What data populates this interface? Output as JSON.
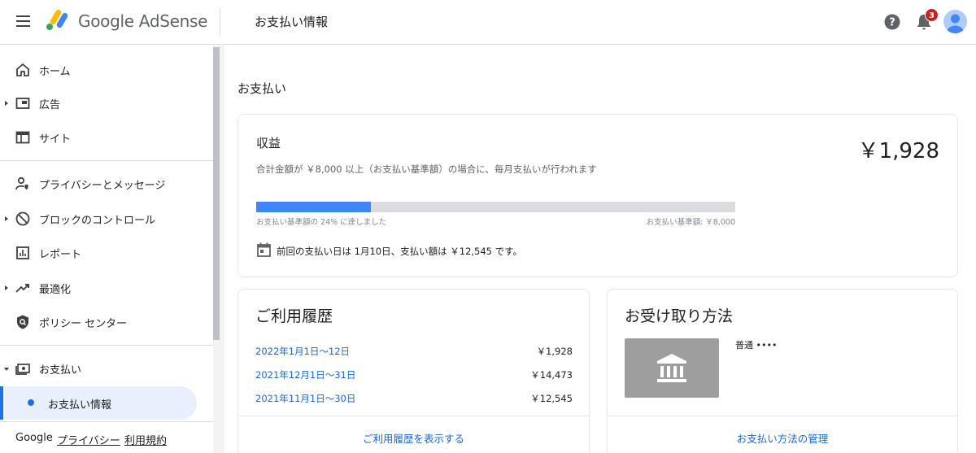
{
  "header": {
    "brand": "Google AdSense",
    "page_title": "お支払い情報",
    "notification_count": "3"
  },
  "sidebar": {
    "items": [
      {
        "label": "ホーム",
        "icon": "home-icon"
      },
      {
        "label": "広告",
        "icon": "ads-icon"
      },
      {
        "label": "サイト",
        "icon": "sites-icon"
      },
      {
        "label": "プライバシーとメッセージ",
        "icon": "privacy-messaging-icon"
      },
      {
        "label": "ブロックのコントロール",
        "icon": "block-icon"
      },
      {
        "label": "レポート",
        "icon": "reports-icon"
      },
      {
        "label": "最適化",
        "icon": "optimization-icon"
      },
      {
        "label": "ポリシー センター",
        "icon": "policy-center-icon"
      },
      {
        "label": "お支払い",
        "icon": "payments-icon"
      }
    ],
    "sub_item": "お支払い情報",
    "footer": {
      "google": "Google",
      "privacy": "プライバシー",
      "terms": "利用規約"
    }
  },
  "main": {
    "section_title": "お支払い",
    "earnings": {
      "title": "収益",
      "description": "合計金額が ￥8,000 以上（お支払い基準額）の場合に、毎月支払いが行われます",
      "amount": "￥1,928",
      "progress_fraction": 0.24,
      "progress_label": "お支払い基準額の 24% に達しました",
      "threshold_label": "お支払い基準額: ￥8,000",
      "last_payment": "前回の支払い日は 1月10日、支払い額は ￥12,545 です。"
    },
    "history": {
      "title": "ご利用履歴",
      "rows": [
        {
          "period": "2022年1月1日～12日",
          "amount": "￥1,928"
        },
        {
          "period": "2021年12月1日～31日",
          "amount": "￥14,473"
        },
        {
          "period": "2021年11月1日～30日",
          "amount": "￥12,545"
        }
      ],
      "link": "ご利用履歴を表示する"
    },
    "payment_method": {
      "title": "お受け取り方法",
      "account_label": "普通 ••••",
      "link": "お支払い方法の管理"
    }
  },
  "colors": {
    "accent": "#1a73e8",
    "progress_fill": "#4285f4",
    "link": "#1967d2",
    "badge": "#c5221f"
  }
}
